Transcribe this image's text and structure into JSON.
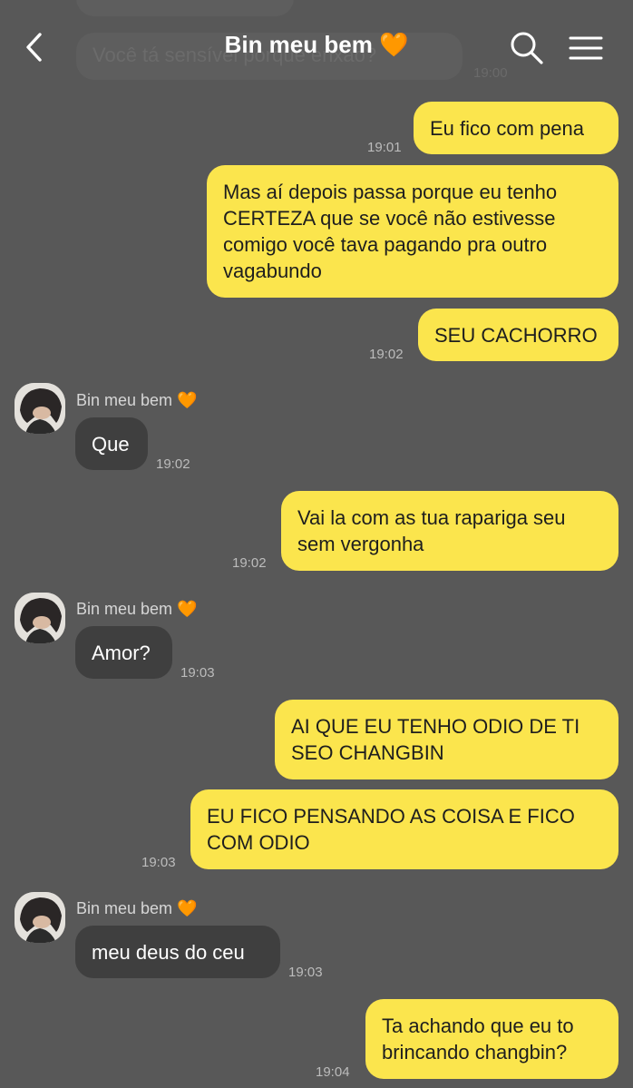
{
  "header": {
    "title": "Bin meu bem",
    "title_emoji": "🧡"
  },
  "ghost_message": {
    "text": "Você tá sensível porque enxão?",
    "time": "19:00"
  },
  "messages": [
    {
      "side": "me",
      "text": "Eu fico com pena",
      "time": "19:01"
    },
    {
      "side": "me",
      "text": "Mas aí depois passa porque eu tenho CERTEZA que se você não estivesse comigo você tava pagando pra outro vagabundo",
      "time": ""
    },
    {
      "side": "me",
      "text": "SEU CACHORRO",
      "time": "19:02"
    },
    {
      "side": "them",
      "sender": "Bin meu bem",
      "sender_emoji": "🧡",
      "text": "Que",
      "time": "19:02"
    },
    {
      "side": "me",
      "text": "Vai la com as tua rapariga seu sem vergonha",
      "time": "19:02"
    },
    {
      "side": "them",
      "sender": "Bin meu bem",
      "sender_emoji": "🧡",
      "text": "Amor?",
      "time": "19:03"
    },
    {
      "side": "me",
      "text": "AI QUE EU TENHO ODIO DE TI SEO CHANGBIN",
      "time": ""
    },
    {
      "side": "me",
      "text": "EU FICO PENSANDO AS COISA E FICO COM ODIO",
      "time": "19:03"
    },
    {
      "side": "them",
      "sender": "Bin meu bem",
      "sender_emoji": "🧡",
      "text": "meu deus do ceu",
      "time": "19:03"
    },
    {
      "side": "me",
      "text": "Ta achando que eu to brincando changbin?",
      "time": "19:04"
    }
  ],
  "colors": {
    "background": "#585858",
    "my_bubble": "#fbe54d",
    "their_bubble": "#3f3f3f",
    "heart": "#f28b1e"
  }
}
